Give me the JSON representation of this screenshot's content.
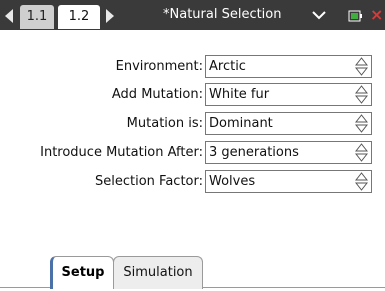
{
  "header": {
    "tabs": [
      {
        "label": "1.1",
        "active": false
      },
      {
        "label": "1.2",
        "active": true
      }
    ],
    "document_title": "*Natural Selection"
  },
  "form": {
    "fields": [
      {
        "label": "Environment:",
        "value": "Arctic"
      },
      {
        "label": "Add Mutation:",
        "value": "White fur"
      },
      {
        "label": "Mutation is:",
        "value": "Dominant"
      },
      {
        "label": "Introduce Mutation After:",
        "value": "3 generations"
      },
      {
        "label": "Selection Factor:",
        "value": "Wolves"
      }
    ]
  },
  "bottom_tabs": [
    {
      "label": "Setup",
      "active": true
    },
    {
      "label": "Simulation",
      "active": false
    }
  ],
  "colors": {
    "topbar": "#3a3a3a",
    "accent": "#4a72a8",
    "close": "#d83a3a",
    "battery": "#3fae3f"
  }
}
